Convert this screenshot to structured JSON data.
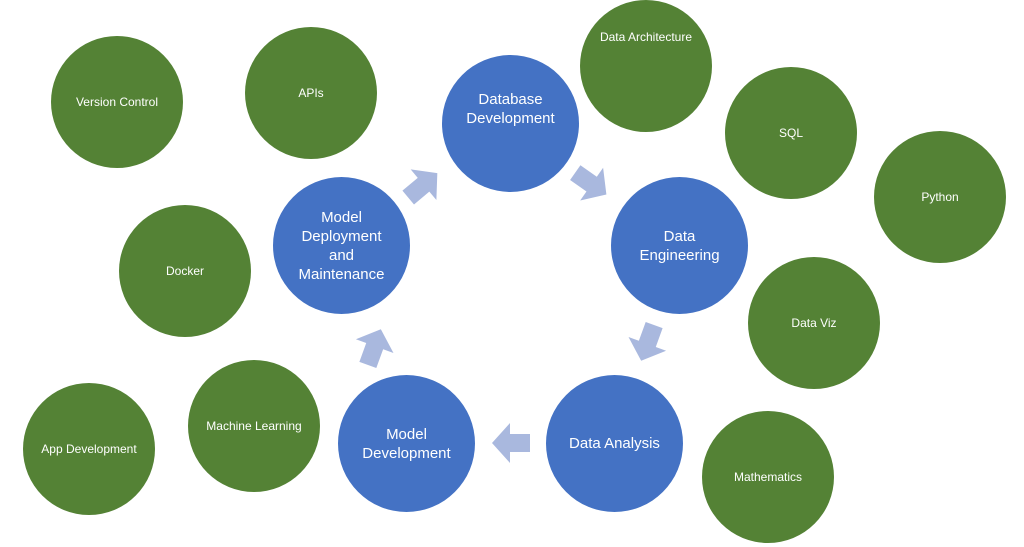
{
  "colors": {
    "core_node": "#4472c4",
    "skill_node": "#548235",
    "arrow": "#a9b8de",
    "text": "#ffffff"
  },
  "core_cycle": [
    {
      "id": "database-development",
      "label": "Database Development"
    },
    {
      "id": "data-engineering",
      "label": "Data Engineering"
    },
    {
      "id": "data-analysis",
      "label": "Data Analysis"
    },
    {
      "id": "model-development",
      "label": "Model Development"
    },
    {
      "id": "model-deployment",
      "label": "Model Deployment and Maintenance"
    }
  ],
  "skills": [
    {
      "id": "version-control",
      "label": "Version Control"
    },
    {
      "id": "apis",
      "label": "APIs"
    },
    {
      "id": "data-architecture",
      "label": "Data Architecture"
    },
    {
      "id": "sql",
      "label": "SQL"
    },
    {
      "id": "python",
      "label": "Python"
    },
    {
      "id": "docker",
      "label": "Docker"
    },
    {
      "id": "data-viz",
      "label": "Data Viz"
    },
    {
      "id": "machine-learning",
      "label": "Machine Learning"
    },
    {
      "id": "app-development",
      "label": "App Development"
    },
    {
      "id": "mathematics",
      "label": "Mathematics"
    }
  ],
  "flow": [
    {
      "from": "database-development",
      "to": "data-engineering"
    },
    {
      "from": "data-engineering",
      "to": "data-analysis"
    },
    {
      "from": "data-analysis",
      "to": "model-development"
    },
    {
      "from": "model-development",
      "to": "model-deployment"
    },
    {
      "from": "model-deployment",
      "to": "database-development"
    }
  ]
}
